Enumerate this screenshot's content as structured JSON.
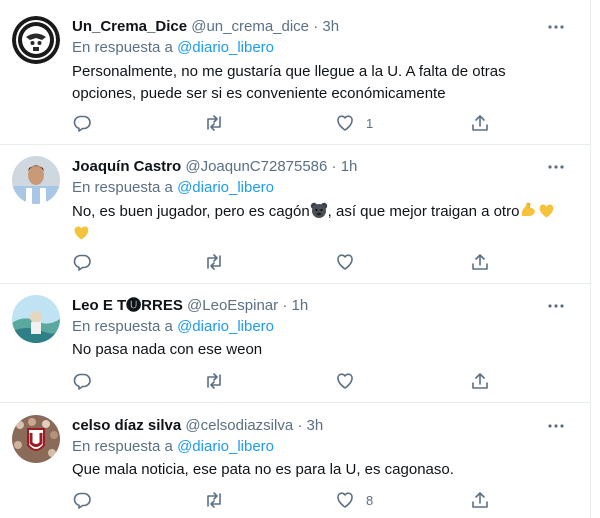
{
  "reply_prefix": "En respuesta a",
  "tweets": [
    {
      "name": "Un_Crema_Dice",
      "handle": "@un_crema_dice",
      "dot": "·",
      "time": "3h",
      "reply_to": "@diario_libero",
      "text": "Personalmente, no me gustaría que llegue a la U. A falta de otras opciones, puede ser si es conveniente económicamente",
      "likes": "1",
      "avatar_icon": "skull-crest-avatar"
    },
    {
      "name": "Joaquín Castro",
      "handle": "@JoaqunC72875586",
      "dot": "·",
      "time": "1h",
      "reply_to": "@diario_libero",
      "text_part1": "No, es buen jugador, pero es cagón",
      "text_part2": ", así que mejor traigan a otro",
      "likes": "",
      "avatar_icon": "footballer-photo-avatar"
    },
    {
      "name": "Leo E T🅤RRES",
      "handle": "@LeoEspinar",
      "dot": "·",
      "time": "1h",
      "reply_to": "@diario_libero",
      "text": "No pasa nada con ese weon",
      "likes": "",
      "avatar_icon": "landscape-photo-avatar"
    },
    {
      "name": "celso díaz silva",
      "handle": "@celsodiazsilva",
      "dot": "·",
      "time": "3h",
      "reply_to": "@diario_libero",
      "text": "Que mala noticia, ese pata no es para la U, es cagonaso.",
      "likes": "8",
      "avatar_icon": "crowd-crest-avatar"
    }
  ],
  "colors": {
    "link": "#1d9bf0",
    "muted": "#5b7083",
    "text": "#0f1419",
    "divider": "#e6ecf0"
  }
}
